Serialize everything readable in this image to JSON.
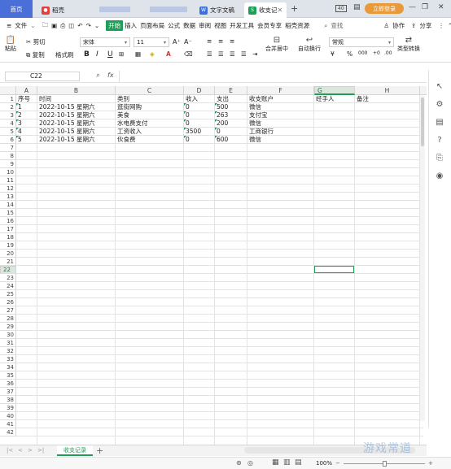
{
  "tabs": {
    "home": "首页",
    "wps_icon_letter": "W",
    "tab2": "稻壳",
    "tab3": "文字文稿",
    "tab4": "收支记",
    "s_icon_letter": "S"
  },
  "window": {
    "login": "立即登录",
    "controls": [
      "❐",
      "—",
      "❐",
      "✕"
    ]
  },
  "menu": {
    "file": "文件",
    "items": [
      "开始",
      "插入",
      "页面布局",
      "公式",
      "数据",
      "审阅",
      "视图",
      "开发工具",
      "会员专享",
      "稻壳资源"
    ],
    "search": "查找",
    "collab": "协作",
    "share": "分享"
  },
  "toolbar": {
    "paste": "粘贴",
    "cut": "剪切",
    "copy": "复制",
    "format_painter": "格式刷",
    "font": "宋体",
    "size": "11",
    "bold": "B",
    "italic": "I",
    "underline": "U",
    "merge": "合并居中",
    "wrap": "自动换行",
    "number_format": "常规",
    "percent": "%",
    "thousands": "000",
    "type_convert": "类型转换"
  },
  "formula": {
    "cell_ref": "C22",
    "fx": "fx",
    "content": ""
  },
  "grid": {
    "columns": [
      "A",
      "B",
      "C",
      "D",
      "E",
      "F",
      "G",
      "H"
    ],
    "selected_column": "G",
    "selected_row": 22,
    "rows": [
      [
        "序号",
        "时间",
        "类别",
        "收入",
        "支出",
        "收支账户",
        "经手人",
        "备注"
      ],
      [
        "1",
        "2022-10-15 星期六",
        "逛街网购",
        "0",
        "500",
        "微信",
        "",
        ""
      ],
      [
        "2",
        "2022-10-15 星期六",
        "美食",
        "0",
        "263",
        "支付宝",
        "",
        ""
      ],
      [
        "3",
        "2022-10-15 星期六",
        "水电费支付",
        "0",
        "200",
        "微信",
        "",
        ""
      ],
      [
        "4",
        "2022-10-15 星期六",
        "工资收入",
        "3500",
        "0",
        "工商银行",
        "",
        ""
      ],
      [
        "5",
        "2022-10-15 星期六",
        "伙食费",
        "0",
        "600",
        "微信",
        "",
        ""
      ]
    ],
    "row_numbers": [
      "1",
      "2",
      "3",
      "4",
      "5",
      "6",
      "7",
      "8",
      "9",
      "10",
      "11",
      "12",
      "13",
      "14",
      "15",
      "16",
      "17",
      "18",
      "19",
      "20",
      "21",
      "22",
      "23",
      "24",
      "25",
      "26",
      "27",
      "28",
      "29",
      "30",
      "31",
      "32",
      "33",
      "34",
      "35",
      "36",
      "37",
      "38",
      "39",
      "40",
      "41",
      "42"
    ]
  },
  "sheets": {
    "active": "收支记录",
    "add": "+"
  },
  "status": {
    "zoom": "100%"
  },
  "watermark": "游戏常道"
}
